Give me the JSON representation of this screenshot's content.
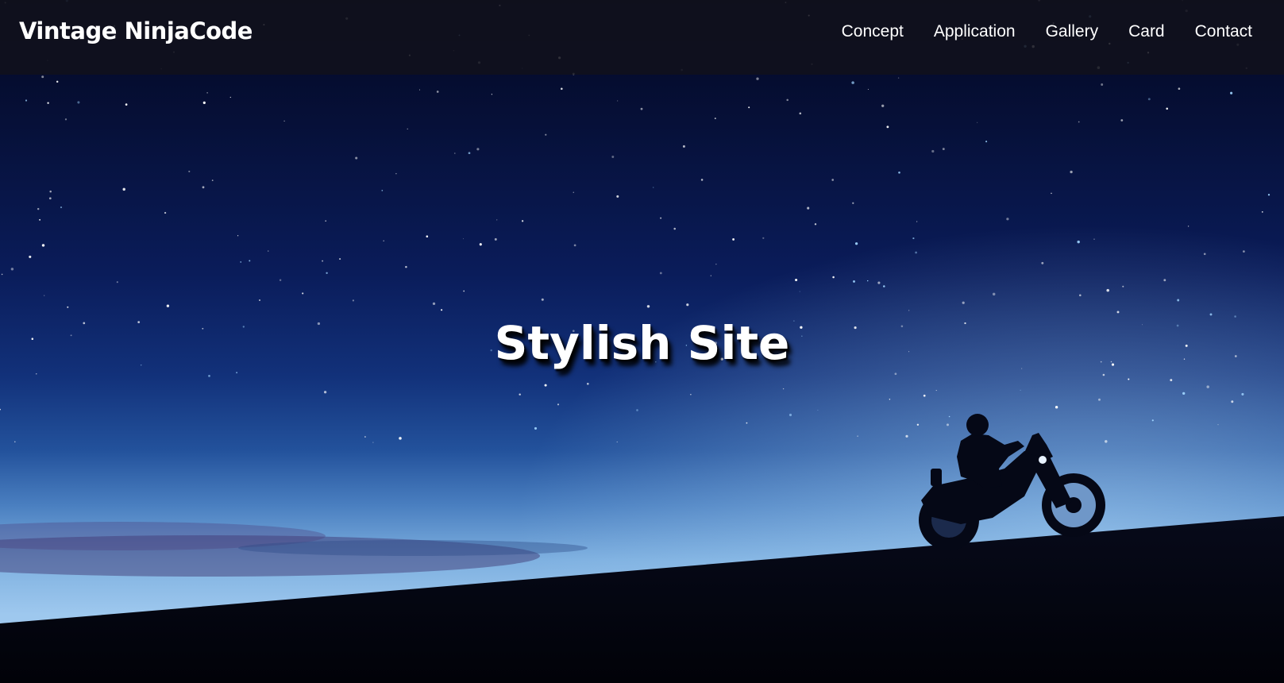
{
  "header": {
    "brand": "Vintage NinjaCode",
    "nav": [
      {
        "label": "Concept"
      },
      {
        "label": "Application"
      },
      {
        "label": "Gallery"
      },
      {
        "label": "Card"
      },
      {
        "label": "Contact"
      }
    ]
  },
  "hero": {
    "title": "Stylish Site",
    "background": "night-sky-motorcycle-rider-image"
  },
  "colors": {
    "sky_top": "#030722",
    "sky_horizon": "#9ec8ee",
    "ground": "#02040d",
    "navbar": "#12121c",
    "text": "#ffffff"
  }
}
